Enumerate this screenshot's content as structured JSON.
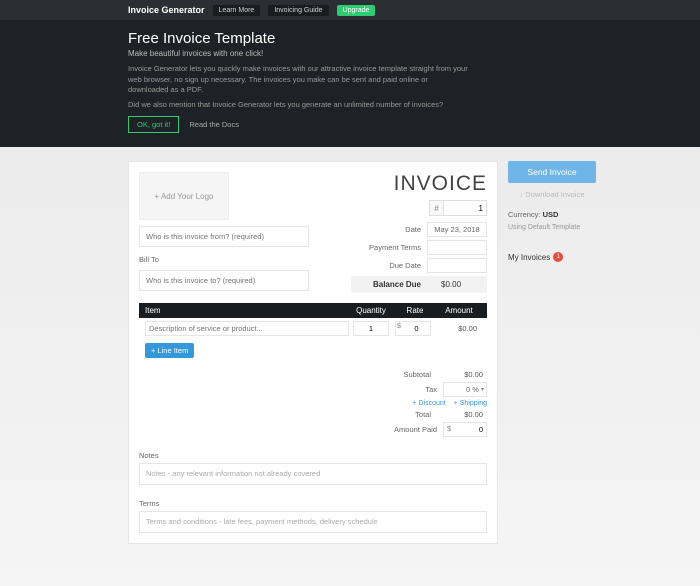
{
  "topbar": {
    "brand": "Invoice Generator",
    "learn": "Learn More",
    "guide": "Invoicing Guide",
    "upgrade": "Upgrade"
  },
  "hero": {
    "title": "Free Invoice Template",
    "sub": "Make beautiful invoices with one click!",
    "p1": "Invoice Generator lets you quickly make invoices with our attractive invoice template straight from your web browser, no sign up necessary. The invoices you make can be sent and paid online or downloaded as a PDF.",
    "p2": "Did we also mention that Invoice Generator lets you generate an unlimited number of invoices?",
    "ok": "OK, got it!",
    "docs": "Read the Docs"
  },
  "invoice": {
    "logo": "+ Add Your Logo",
    "title": "INVOICE",
    "numlabel": "#",
    "num": "1",
    "from_ph": "Who is this invoice from? (required)",
    "billto": "Bill To",
    "to_ph": "Who is this invoice to? (required)",
    "meta": {
      "date": "Date",
      "date_v": "May 23, 2018",
      "terms": "Payment Terms",
      "due": "Due Date",
      "balance": "Balance Due",
      "balance_v": "$0.00"
    },
    "cols": {
      "item": "Item",
      "qty": "Quantity",
      "rate": "Rate",
      "amount": "Amount"
    },
    "row": {
      "desc_ph": "Description of service or product...",
      "qty": "1",
      "rate_prefix": "$",
      "rate": "0",
      "amount": "$0.00"
    },
    "addline": "+ Line Item",
    "totals": {
      "subtotal": "Subtotal",
      "subtotal_v": "$0.00",
      "tax": "Tax",
      "tax_v": "0 %",
      "discount": "+ Discount",
      "shipping": "+ Shipping",
      "total": "Total",
      "total_v": "$0.00",
      "paid": "Amount Paid",
      "paid_prefix": "$",
      "paid_v": "0"
    },
    "notes": "Notes",
    "notes_ph": "Notes - any relevant information not already covered",
    "terms": "Terms",
    "terms_ph": "Terms and conditions - late fees, payment methods, delivery schedule"
  },
  "side": {
    "send": "Send Invoice",
    "download": "↓ Download Invoice",
    "currency_l": "Currency:",
    "currency_v": "USD",
    "template": "Using Default Template",
    "myinv": "My Invoices",
    "count": "1"
  }
}
